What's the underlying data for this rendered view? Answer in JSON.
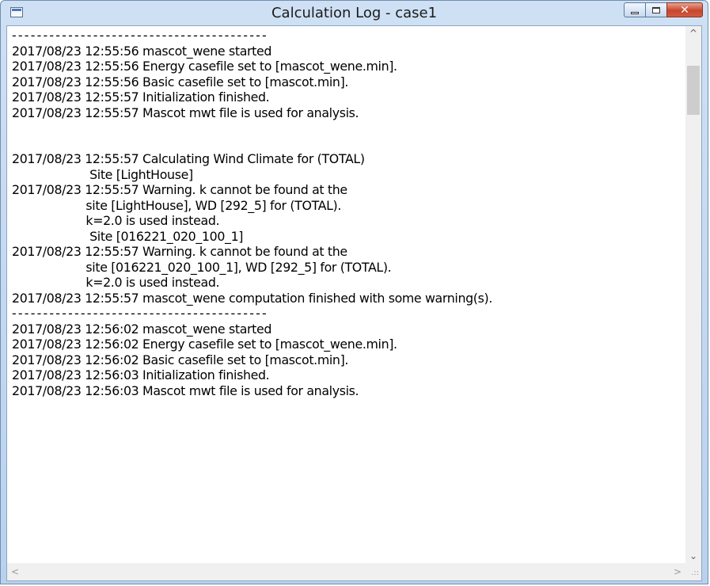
{
  "window": {
    "title": "Calculation Log - case1",
    "caption_buttons": {
      "minimize": "",
      "maximize": "",
      "close": "✕"
    }
  },
  "log_lines": [
    {
      "text": "-----------------------------------------",
      "kind": "separator"
    },
    {
      "text": "2017/08/23 12:55:56 mascot_wene started",
      "kind": "text"
    },
    {
      "text": "2017/08/23 12:55:56 Energy casefile set to [mascot_wene.min].",
      "kind": "text"
    },
    {
      "text": "2017/08/23 12:55:56 Basic casefile set to [mascot.min].",
      "kind": "text"
    },
    {
      "text": "2017/08/23 12:55:57 Initialization finished.",
      "kind": "text"
    },
    {
      "text": "2017/08/23 12:55:57 Mascot mwt file is used for analysis.",
      "kind": "text"
    },
    {
      "text": "",
      "kind": "blank"
    },
    {
      "text": "",
      "kind": "blank"
    },
    {
      "text": "2017/08/23 12:55:57 Calculating Wind Climate for (TOTAL)",
      "kind": "text"
    },
    {
      "text": "                     Site [LightHouse]",
      "kind": "text"
    },
    {
      "text": "2017/08/23 12:55:57 Warning. k cannot be found at the",
      "kind": "text"
    },
    {
      "text": "                    site [LightHouse], WD [292_5] for (TOTAL).",
      "kind": "text"
    },
    {
      "text": "                    k=2.0 is used instead.",
      "kind": "text"
    },
    {
      "text": "                     Site [016221_020_100_1]",
      "kind": "text"
    },
    {
      "text": "2017/08/23 12:55:57 Warning. k cannot be found at the",
      "kind": "text"
    },
    {
      "text": "                    site [016221_020_100_1], WD [292_5] for (TOTAL).",
      "kind": "text"
    },
    {
      "text": "                    k=2.0 is used instead.",
      "kind": "text"
    },
    {
      "text": "2017/08/23 12:55:57 mascot_wene computation finished with some warning(s).",
      "kind": "text"
    },
    {
      "text": "-----------------------------------------",
      "kind": "separator"
    },
    {
      "text": "2017/08/23 12:56:02 mascot_wene started",
      "kind": "text"
    },
    {
      "text": "2017/08/23 12:56:02 Energy casefile set to [mascot_wene.min].",
      "kind": "text"
    },
    {
      "text": "2017/08/23 12:56:02 Basic casefile set to [mascot.min].",
      "kind": "text"
    },
    {
      "text": "2017/08/23 12:56:03 Initialization finished.",
      "kind": "text"
    },
    {
      "text": "2017/08/23 12:56:03 Mascot mwt file is used for analysis.",
      "kind": "text"
    }
  ],
  "scrollbars": {
    "up_arrow": "^",
    "down_arrow": "⌄",
    "left_arrow": "<",
    "right_arrow": ">",
    "size_grip": ".::"
  },
  "icons": {
    "app": "window-app-icon",
    "minimize": "minimize-icon",
    "maximize": "maximize-icon",
    "close": "close-icon"
  },
  "colors": {
    "title_bar": "#c4d8f0",
    "close_button": "#c7452c",
    "log_background": "#ffffff",
    "log_text": "#000000"
  }
}
